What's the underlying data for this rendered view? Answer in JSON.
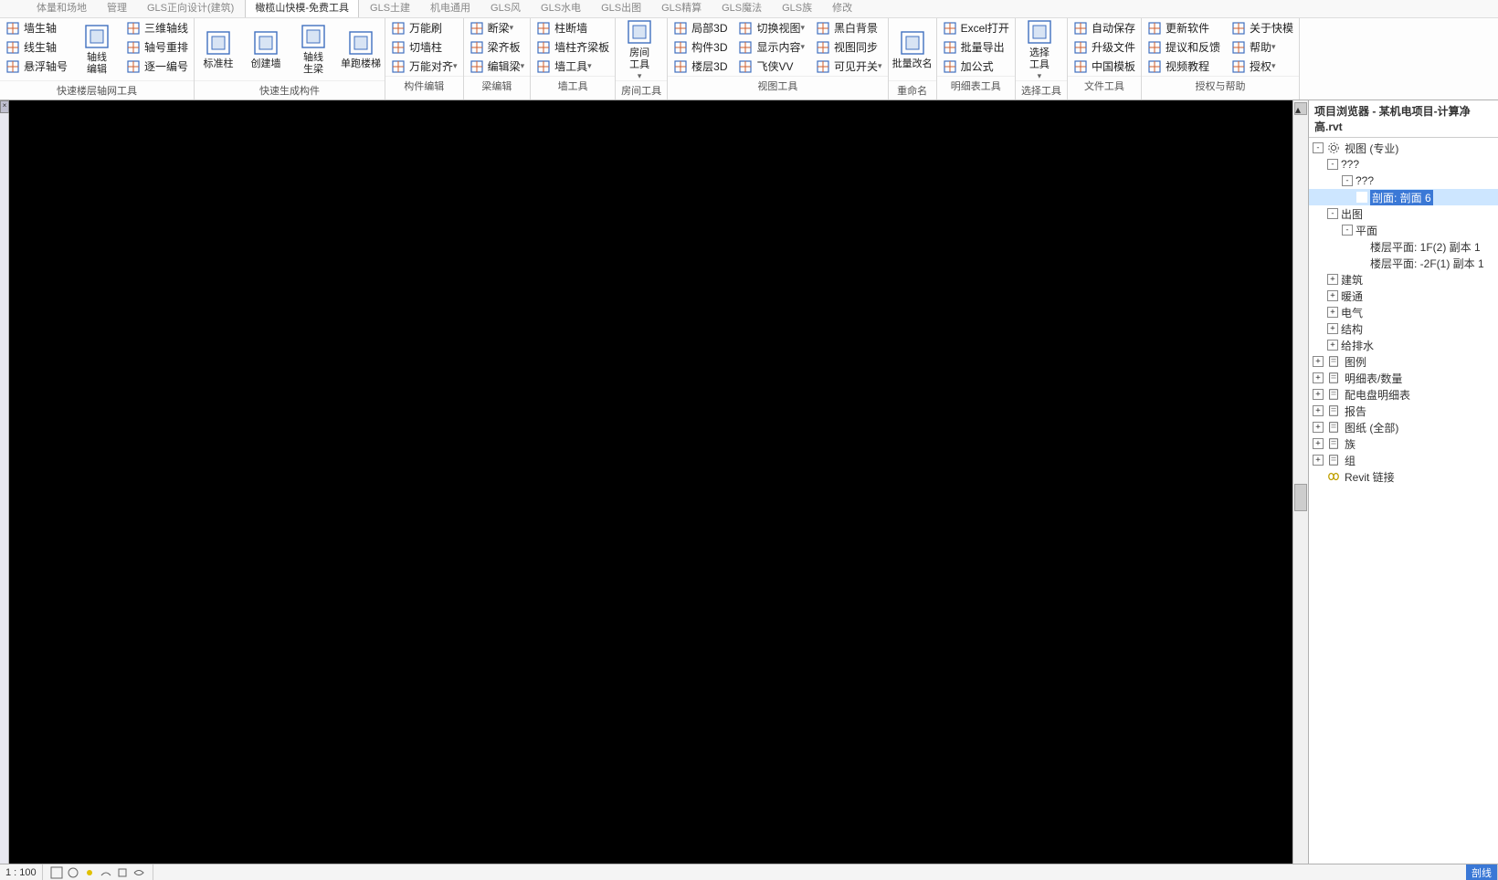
{
  "tabs": [
    "体量和场地",
    "管理",
    "GLS正向设计(建筑)",
    "橄榄山快模-免费工具",
    "GLS土建",
    "机电通用",
    "GLS风",
    "GLS水电",
    "GLS出图",
    "GLS精算",
    "GLS魔法",
    "GLS族",
    "修改"
  ],
  "active_tab": 3,
  "ribbon": {
    "g1": {
      "label": "快速楼层轴网工具",
      "col1": [
        "墙生轴",
        "线生轴",
        "悬浮轴号"
      ],
      "col2": [
        "轴线",
        "编辑"
      ],
      "col3": [
        "三维轴线",
        "轴号重排",
        "逐一编号"
      ]
    },
    "g2": {
      "label": "快速生成构件",
      "b1": "标准柱",
      "b2": "创建墙",
      "b3": "轴线\n生梁",
      "b4": "单跑楼梯"
    },
    "g3": {
      "label": "构件编辑",
      "col1": [
        "万能刷",
        "切墙柱",
        "万能对齐"
      ]
    },
    "g4": {
      "label": "梁编辑",
      "col1": [
        "断梁",
        "梁齐板",
        "编辑梁"
      ]
    },
    "g5": {
      "label": "墙工具",
      "col1": [
        "柱断墙",
        "墙柱齐梁板",
        "墙工具"
      ]
    },
    "g6": {
      "label": "房间工具",
      "b1": "房间\n工具"
    },
    "g7": {
      "label": "视图工具",
      "col1": [
        "局部3D",
        "构件3D",
        "楼层3D"
      ],
      "col2": [
        "切换视图",
        "显示内容",
        "飞侠VV"
      ],
      "col3": [
        "黑白背景",
        "视图同步",
        "可见开关"
      ]
    },
    "g8": {
      "label": "重命名",
      "b1": "批量改名"
    },
    "g9": {
      "label": "明细表工具",
      "col1": [
        "Excel打开",
        "批量导出",
        "加公式"
      ]
    },
    "g10": {
      "label": "选择工具",
      "b1": "选择\n工具"
    },
    "g11": {
      "label": "文件工具",
      "col1": [
        "自动保存",
        "升级文件",
        "中国模板"
      ]
    },
    "g12": {
      "label": "授权与帮助",
      "col1": [
        "更新软件",
        "提议和反馈",
        "视频教程"
      ],
      "col2": [
        "关于快模",
        "帮助",
        "授权"
      ]
    }
  },
  "browser": {
    "title": "项目浏览器 - 某机电项目-计算净高.rvt",
    "nodes": [
      {
        "d": 0,
        "tw": "-",
        "ic": "view",
        "t": "视图 (专业)"
      },
      {
        "d": 1,
        "tw": "-",
        "t": "???"
      },
      {
        "d": 2,
        "tw": "-",
        "t": "???"
      },
      {
        "d": 3,
        "tw": "",
        "t": "剖面: 剖面 6",
        "sel": true
      },
      {
        "d": 1,
        "tw": "-",
        "t": "出图"
      },
      {
        "d": 2,
        "tw": "-",
        "t": "平面"
      },
      {
        "d": 3,
        "tw": "",
        "t": "楼层平面: 1F(2) 副本 1"
      },
      {
        "d": 3,
        "tw": "",
        "t": "楼层平面: -2F(1) 副本 1"
      },
      {
        "d": 1,
        "tw": "+",
        "t": "建筑"
      },
      {
        "d": 1,
        "tw": "+",
        "t": "暖通"
      },
      {
        "d": 1,
        "tw": "+",
        "t": "电气"
      },
      {
        "d": 1,
        "tw": "+",
        "t": "结构"
      },
      {
        "d": 1,
        "tw": "+",
        "t": "给排水"
      },
      {
        "d": 0,
        "tw": "+",
        "ic": "leg",
        "t": "图例"
      },
      {
        "d": 0,
        "tw": "+",
        "ic": "sch",
        "t": "明细表/数量"
      },
      {
        "d": 0,
        "tw": "+",
        "ic": "sch",
        "t": "配电盘明细表"
      },
      {
        "d": 0,
        "tw": "+",
        "ic": "rep",
        "t": "报告"
      },
      {
        "d": 0,
        "tw": "+",
        "ic": "sheet",
        "t": "图纸 (全部)"
      },
      {
        "d": 0,
        "tw": "+",
        "ic": "fam",
        "t": "族"
      },
      {
        "d": 0,
        "tw": "+",
        "ic": "grp",
        "t": "组"
      },
      {
        "d": 0,
        "tw": "",
        "ic": "link",
        "t": "Revit 链接"
      }
    ]
  },
  "status": {
    "zoom": "1 : 100",
    "right": "剖线"
  }
}
